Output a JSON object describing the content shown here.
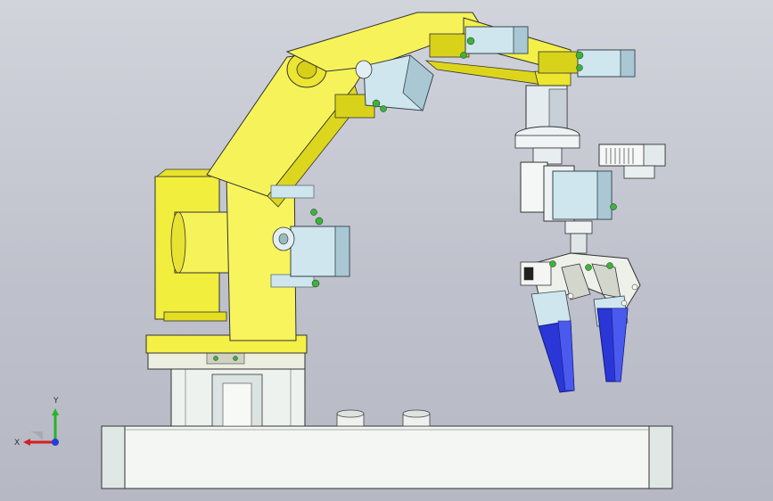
{
  "viewport": {
    "background_top": "#d2d4dc",
    "background_bottom": "#b6b8c4"
  },
  "model": {
    "colors": {
      "arm_yellow": "#f4f046",
      "arm_yellow_shade": "#d9d21a",
      "servo_blue": "#cfe6ee",
      "servo_edge": "#5b6d74",
      "gripper_blue": "#2a36d6",
      "base_white": "#f3f6f2",
      "screw_green": "#3cb43c"
    }
  },
  "triad": {
    "x_label": "X",
    "y_label": "Y",
    "x_color": "#d42020",
    "y_color": "#28b428",
    "z_color": "#2040d8"
  }
}
